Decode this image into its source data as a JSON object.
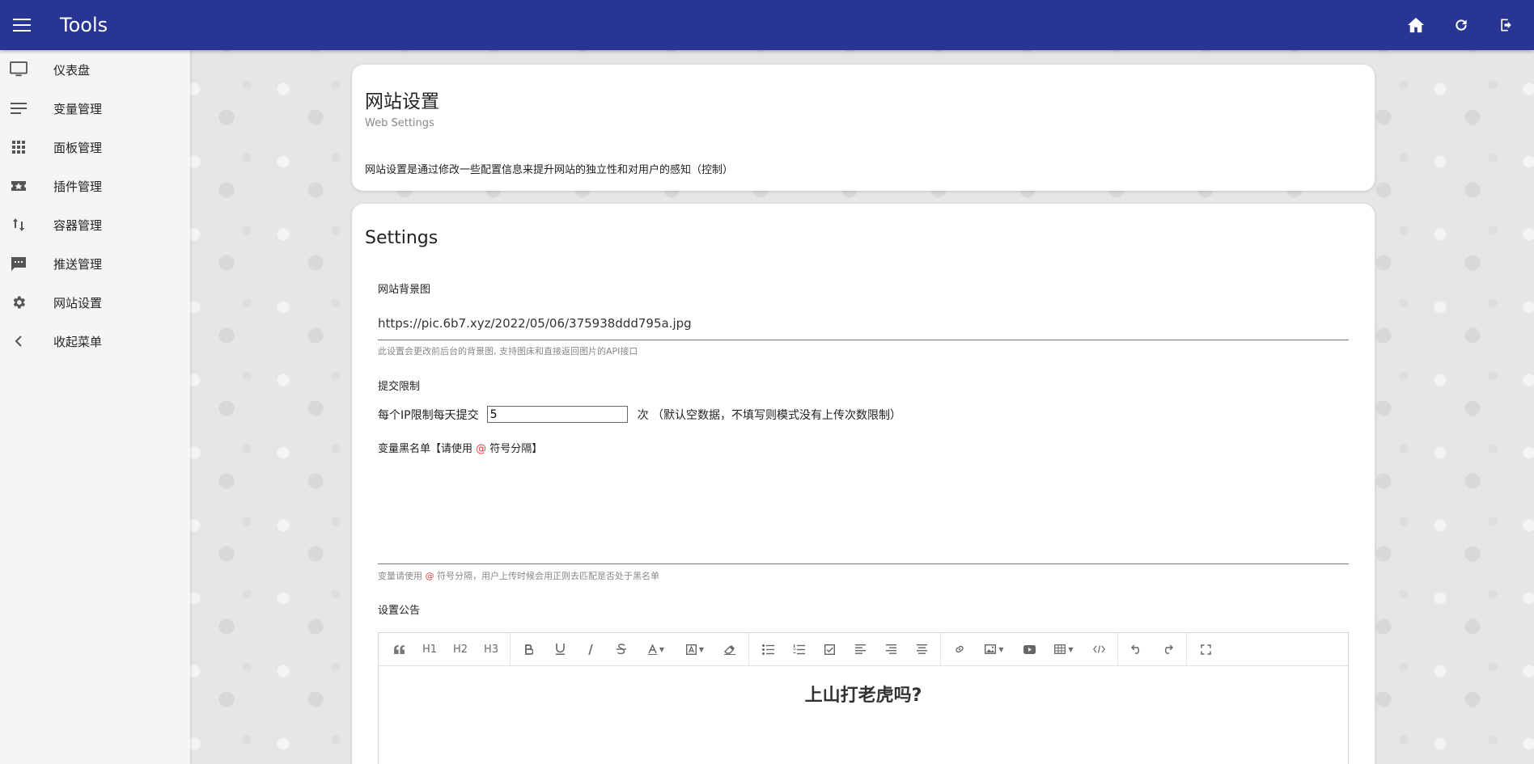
{
  "app": {
    "title": "Tools"
  },
  "sidebar": {
    "items": [
      {
        "label": "仪表盘",
        "icon": "monitor-icon"
      },
      {
        "label": "变量管理",
        "icon": "list-icon"
      },
      {
        "label": "面板管理",
        "icon": "apps-grid-icon"
      },
      {
        "label": "插件管理",
        "icon": "star-box-icon"
      },
      {
        "label": "容器管理",
        "icon": "swap-vertical-icon"
      },
      {
        "label": "推送管理",
        "icon": "message-icon"
      },
      {
        "label": "网站设置",
        "icon": "gear-icon"
      },
      {
        "label": "收起菜单",
        "icon": "chevron-left-icon"
      }
    ]
  },
  "header_card": {
    "title": "网站设置",
    "subtitle": "Web Settings",
    "description": "网站设置是通过修改一些配置信息来提升网站的独立性和对用户的感知（控制）"
  },
  "settings": {
    "title": "Settings",
    "bg_label": "网站背景图",
    "bg_value": "https://pic.6b7.xyz/2022/05/06/375938ddd795a.jpg",
    "bg_hint": "此设置会更改前后台的背景图, 支持图床和直接返回图片的API接口",
    "limit_label": "提交限制",
    "limit_prefix": "每个IP限制每天提交",
    "limit_value": "5",
    "limit_suffix": "次 （默认空数据，不填写则模式没有上传次数限制）",
    "blacklist_label_pre": "变量黑名单【请使用 ",
    "at_symbol": "@",
    "blacklist_label_post": " 符号分隔】",
    "blacklist_value": "",
    "blacklist_hint_pre": "变量请使用 ",
    "blacklist_hint_post": " 符号分隔，用户上传时候会用正则去匹配是否处于黑名单",
    "notice_label": "设置公告",
    "editor_toolbar": {
      "h1": "H1",
      "h2": "H2",
      "h3": "H3"
    },
    "editor_content": "上山打老虎吗?"
  },
  "colors": {
    "appbar": "#283593",
    "at_symbol": "#e53935"
  }
}
